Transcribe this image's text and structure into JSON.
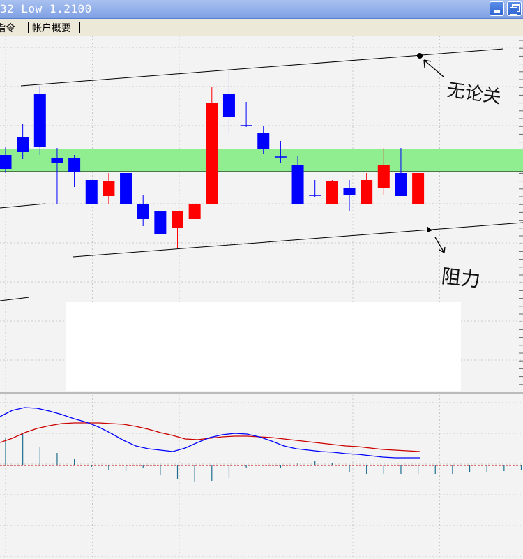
{
  "window": {
    "title": "32 Low 1.2100",
    "buttons": [
      "minimize-icon",
      "restore-icon"
    ],
    "titlebar_color": "#7fa0e4"
  },
  "tabs": [
    {
      "label": "指令"
    },
    {
      "label": "帐户概要"
    }
  ],
  "annotations": {
    "resistance_label": "无论关",
    "support_label": "阻力"
  },
  "colors": {
    "bull_candle": "#ff0000",
    "bear_candle": "#0000ff",
    "zone": "#90ee90",
    "macd_line": "#0000ff",
    "signal_line": "#cc0000",
    "zero_line": "#cc0000",
    "background": "#f3f3f3"
  },
  "chart_data": {
    "type": "candlestick",
    "candles": [
      {
        "o": 222,
        "c": 242,
        "h": 210,
        "l": 248
      },
      {
        "o": 196,
        "c": 218,
        "h": 178,
        "l": 228
      },
      {
        "o": 135,
        "c": 210,
        "h": 125,
        "l": 222
      },
      {
        "o": 226,
        "c": 234,
        "h": 212,
        "l": 292
      },
      {
        "o": 226,
        "c": 246,
        "h": 222,
        "l": 268
      },
      {
        "o": 258,
        "c": 292,
        "h": 258,
        "l": 292
      },
      {
        "o": 281,
        "c": 259,
        "h": 248,
        "l": 292
      },
      {
        "o": 248,
        "c": 292,
        "h": 248,
        "l": 292
      },
      {
        "o": 292,
        "c": 314,
        "h": 280,
        "l": 324
      },
      {
        "o": 302,
        "c": 336,
        "h": 302,
        "l": 336
      },
      {
        "o": 326,
        "c": 302,
        "h": 302,
        "l": 356
      },
      {
        "o": 314,
        "c": 292,
        "h": 292,
        "l": 314
      },
      {
        "o": 292,
        "c": 147,
        "h": 125,
        "l": 292
      },
      {
        "o": 135,
        "c": 168,
        "h": 101,
        "l": 190
      },
      {
        "o": 180,
        "c": 182,
        "h": 146,
        "l": 182
      },
      {
        "o": 190,
        "c": 213,
        "h": 180,
        "l": 220
      },
      {
        "o": 225,
        "c": 227,
        "h": 202,
        "l": 234
      },
      {
        "o": 236,
        "c": 292,
        "h": 224,
        "l": 292
      },
      {
        "o": 280,
        "c": 282,
        "h": 258,
        "l": 282
      },
      {
        "o": 292,
        "c": 259,
        "h": 258,
        "l": 292
      },
      {
        "o": 269,
        "c": 280,
        "h": 258,
        "l": 302
      },
      {
        "o": 292,
        "c": 258,
        "h": 248,
        "l": 292
      },
      {
        "o": 270,
        "c": 236,
        "h": 212,
        "l": 280
      },
      {
        "o": 248,
        "c": 281,
        "h": 212,
        "l": 281
      },
      {
        "o": 292,
        "c": 248,
        "h": 248,
        "l": 292
      }
    ],
    "zone": [
      213,
      247
    ],
    "resistance_line": [
      [
        30,
        123
      ],
      [
        722,
        70
      ]
    ],
    "support_line": [
      [
        105,
        368
      ],
      [
        750,
        319
      ]
    ],
    "left_line_1": [
      [
        0,
        298
      ],
      [
        65,
        292
      ]
    ],
    "left_line_2": [
      [
        0,
        431
      ],
      [
        42,
        426
      ]
    ],
    "horizontal_line": 246,
    "macd": {
      "macd_line": [
        597,
        588,
        584,
        585,
        589,
        594,
        600,
        605,
        612,
        621,
        631,
        639,
        643,
        645,
        647,
        642,
        634,
        627,
        623,
        621,
        622,
        626,
        632,
        639,
        643,
        645,
        647,
        648,
        650,
        651,
        653,
        655,
        656,
        656,
        656
      ],
      "signal_line": [
        634,
        628,
        620,
        614,
        610,
        607,
        606,
        606,
        606,
        607,
        608,
        611,
        615,
        620,
        624,
        629,
        630,
        628,
        626,
        625,
        625,
        626,
        627,
        629,
        631,
        633,
        635,
        637,
        639,
        640,
        642,
        644,
        645,
        646,
        647
      ],
      "histogram": [
        40,
        45,
        26,
        18,
        10,
        -2,
        -6,
        -8,
        -4,
        -14,
        -20,
        -23,
        -22,
        -18,
        -4,
        0,
        -4,
        4,
        6,
        4,
        -10,
        -12,
        -12,
        -12,
        -12,
        -12,
        -12,
        -10,
        -10,
        -8,
        -6,
        -6
      ]
    }
  }
}
